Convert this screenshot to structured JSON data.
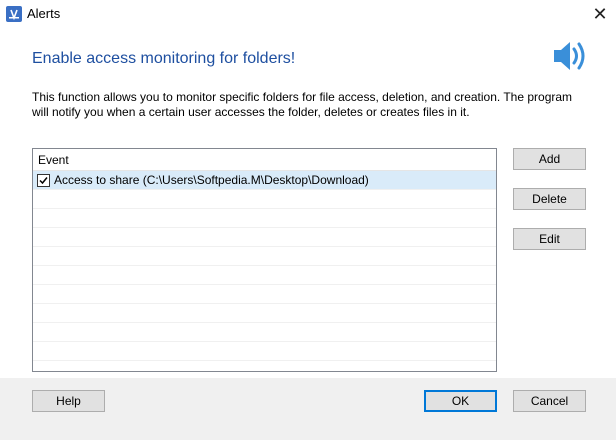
{
  "window": {
    "title": "Alerts",
    "close_glyph": "✕"
  },
  "header": {
    "heading": "Enable access monitoring for folders!",
    "description": "This function allows you to monitor specific folders for file access, deletion, and creation. The program will notify you when a certain user accesses the folder, deletes or creates files in it.",
    "icon": "speaker-icon"
  },
  "event_list": {
    "column_header": "Event",
    "items": [
      {
        "label": "Access to share (C:\\Users\\Softpedia.M\\Desktop\\Download)",
        "checked": true,
        "selected": true
      }
    ]
  },
  "side_buttons": {
    "add": "Add",
    "delete": "Delete",
    "edit": "Edit"
  },
  "footer": {
    "help": "Help",
    "ok": "OK",
    "cancel": "Cancel"
  },
  "colors": {
    "heading": "#1e4fa0",
    "accent": "#0078d7",
    "selection": "#d9ebf9"
  }
}
